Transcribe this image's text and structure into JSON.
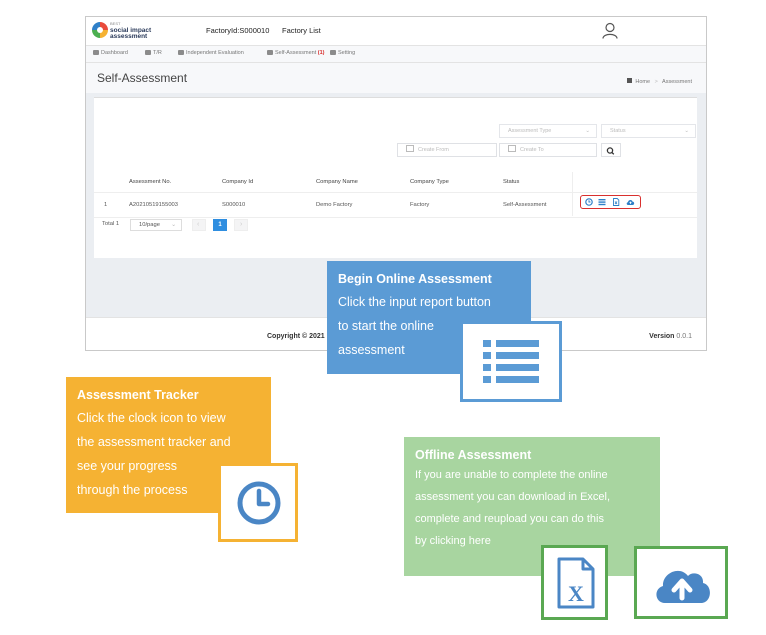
{
  "app": {
    "logo_small": "BEST",
    "logo_line1": "social impact",
    "logo_line2": "assessment",
    "factory_id": "FactoryId:S000010",
    "factory_list": "Factory List",
    "nav": [
      {
        "label": "Dashboard",
        "icon": "dashboard-icon"
      },
      {
        "label": "T/R",
        "icon": "eye-icon"
      },
      {
        "label": "Independent Evaluation",
        "icon": "evaluation-icon"
      },
      {
        "label": "Self-Assessment",
        "badge": "(1)",
        "icon": "document-icon"
      },
      {
        "label": "Setting",
        "icon": "gear-icon"
      }
    ],
    "page_title": "Self-Assessment",
    "breadcrumb": {
      "home": "Home",
      "sep": ">",
      "current": "Assessment"
    },
    "filters": {
      "assessment_type": "Assessment Type",
      "status": "Status",
      "create_from": "Create From",
      "create_to": "Create To"
    },
    "table": {
      "headers": [
        "Assessment No.",
        "Company Id",
        "Company Name",
        "Company Type",
        "Status"
      ],
      "rows": [
        {
          "index": "1",
          "assessment_no": "A20210519155003",
          "company_id": "S000010",
          "company_name": "Demo Factory",
          "company_type": "Factory",
          "status": "Self-Assessment"
        }
      ],
      "action_icons": [
        "clock-icon",
        "list-icon",
        "excel-icon",
        "cloud-upload-icon"
      ]
    },
    "pagination": {
      "total": "Total 1",
      "page_size": "10/page",
      "current_page": "1"
    },
    "footer": {
      "copyright": "Copyright © 2021",
      "version_label": "Version",
      "version_value": "0.0.1"
    }
  },
  "callouts": {
    "online": {
      "title": "Begin Online Assessment",
      "lines": [
        "Click the input report button",
        "to start the online",
        "assessment"
      ],
      "icon": "list-icon",
      "color": "#5b9bd5"
    },
    "tracker": {
      "title": "Assessment Tracker",
      "lines": [
        "Click the clock icon to view",
        "the assessment tracker and",
        "see your progress",
        "through the process"
      ],
      "icon": "clock-icon",
      "color": "#f5b233"
    },
    "offline": {
      "title": "Offline Assessment",
      "lines": [
        "If you are unable to complete the online",
        "assessment you can download in Excel,",
        "complete and reupload you can do this",
        "by clicking here"
      ],
      "icons": [
        "excel-icon",
        "cloud-upload-icon"
      ],
      "color": "#a8d5a0"
    }
  }
}
